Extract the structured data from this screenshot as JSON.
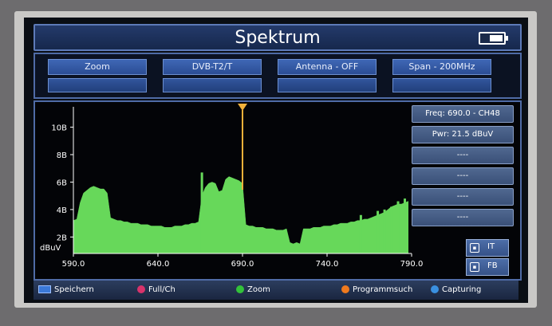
{
  "header": {
    "title": "Spektrum"
  },
  "function_buttons": [
    {
      "label": "Zoom"
    },
    {
      "label": "DVB-T2/T"
    },
    {
      "label": "Antenna - OFF"
    },
    {
      "label": "Span - 200MHz"
    }
  ],
  "side_panel": {
    "freq_label": "Freq: 690.0 - CH48",
    "pwr_label": "Pwr: 21.5 dBuV",
    "empty_slots": [
      "----",
      "----",
      "----",
      "----"
    ]
  },
  "rf_buttons": [
    {
      "key": "IT",
      "label": "IT"
    },
    {
      "key": "FB",
      "label": "FB"
    }
  ],
  "bottom_bar": [
    {
      "label": "Speichern",
      "color": "#3a78d8"
    },
    {
      "label": "Full/Ch",
      "color": "#d8336b"
    },
    {
      "label": "Zoom",
      "color": "#33c23a"
    },
    {
      "label": "Programmsuch",
      "color": "#f07a1e"
    },
    {
      "label": "Capturing",
      "color": "#3a90e0"
    }
  ],
  "chart_data": {
    "type": "area",
    "x": [
      590,
      592,
      594,
      596,
      598,
      600,
      602,
      604,
      606,
      608,
      610,
      612,
      614,
      616,
      618,
      620,
      622,
      624,
      626,
      628,
      630,
      632,
      634,
      636,
      638,
      640,
      642,
      644,
      646,
      648,
      650,
      652,
      654,
      656,
      658,
      660,
      662,
      664,
      666,
      668,
      670,
      672,
      674,
      676,
      678,
      680,
      682,
      684,
      686,
      688,
      690,
      692,
      694,
      696,
      698,
      700,
      702,
      704,
      706,
      708,
      710,
      712,
      714,
      716,
      718,
      720,
      722,
      724,
      726,
      728,
      730,
      732,
      734,
      736,
      738,
      740,
      742,
      744,
      746,
      748,
      750,
      752,
      754,
      756,
      758,
      760,
      762,
      764,
      766,
      768,
      770,
      772,
      774,
      776,
      778,
      780,
      782,
      784,
      786,
      788
    ],
    "y": [
      3.2,
      3.3,
      4.5,
      5.2,
      5.4,
      5.6,
      5.7,
      5.6,
      5.5,
      5.5,
      5.2,
      3.4,
      3.3,
      3.2,
      3.2,
      3.1,
      3.1,
      3.0,
      3.0,
      3.0,
      2.9,
      2.9,
      2.9,
      2.8,
      2.8,
      2.8,
      2.8,
      2.7,
      2.7,
      2.7,
      2.8,
      2.8,
      2.8,
      2.9,
      2.9,
      3.0,
      3.0,
      3.1,
      5.0,
      5.6,
      5.9,
      6.0,
      5.9,
      5.3,
      5.4,
      6.2,
      6.4,
      6.3,
      6.2,
      6.1,
      5.9,
      2.9,
      2.8,
      2.8,
      2.7,
      2.7,
      2.7,
      2.6,
      2.6,
      2.6,
      2.5,
      2.5,
      2.5,
      2.6,
      1.6,
      1.5,
      1.6,
      1.5,
      2.6,
      2.6,
      2.6,
      2.7,
      2.7,
      2.7,
      2.8,
      2.8,
      2.8,
      2.9,
      2.9,
      3.0,
      3.0,
      3.0,
      3.1,
      3.1,
      3.2,
      3.2,
      3.3,
      3.3,
      3.4,
      3.5,
      3.6,
      3.7,
      3.8,
      4.0,
      4.2,
      4.3,
      4.4,
      4.4,
      4.5,
      4.6
    ],
    "spikes": [
      {
        "x": 666,
        "y": 6.7
      },
      {
        "x": 760,
        "y": 3.6
      },
      {
        "x": 770,
        "y": 3.9
      },
      {
        "x": 774,
        "y": 4.0
      },
      {
        "x": 778,
        "y": 4.2
      },
      {
        "x": 782,
        "y": 4.6
      },
      {
        "x": 786,
        "y": 4.8
      }
    ],
    "marker_x": 690,
    "y_ticks": [
      {
        "value": 2,
        "label": "2B"
      },
      {
        "value": 4,
        "label": "4B"
      },
      {
        "value": 6,
        "label": "6B"
      },
      {
        "value": 8,
        "label": "8B"
      },
      {
        "value": 10,
        "label": "10B"
      }
    ],
    "x_ticks": [
      {
        "value": 590,
        "label": "590.0"
      },
      {
        "value": 640,
        "label": "640.0"
      },
      {
        "value": 690,
        "label": "690.0"
      },
      {
        "value": 740,
        "label": "740.0"
      },
      {
        "value": 790,
        "label": "790.0"
      }
    ],
    "ylabel": "dBuV",
    "xlim": [
      590,
      790
    ],
    "ylim": [
      0.8,
      11.6
    ],
    "grid": false,
    "fill_color": "#67d85a",
    "marker_color": "#f2b13a"
  }
}
